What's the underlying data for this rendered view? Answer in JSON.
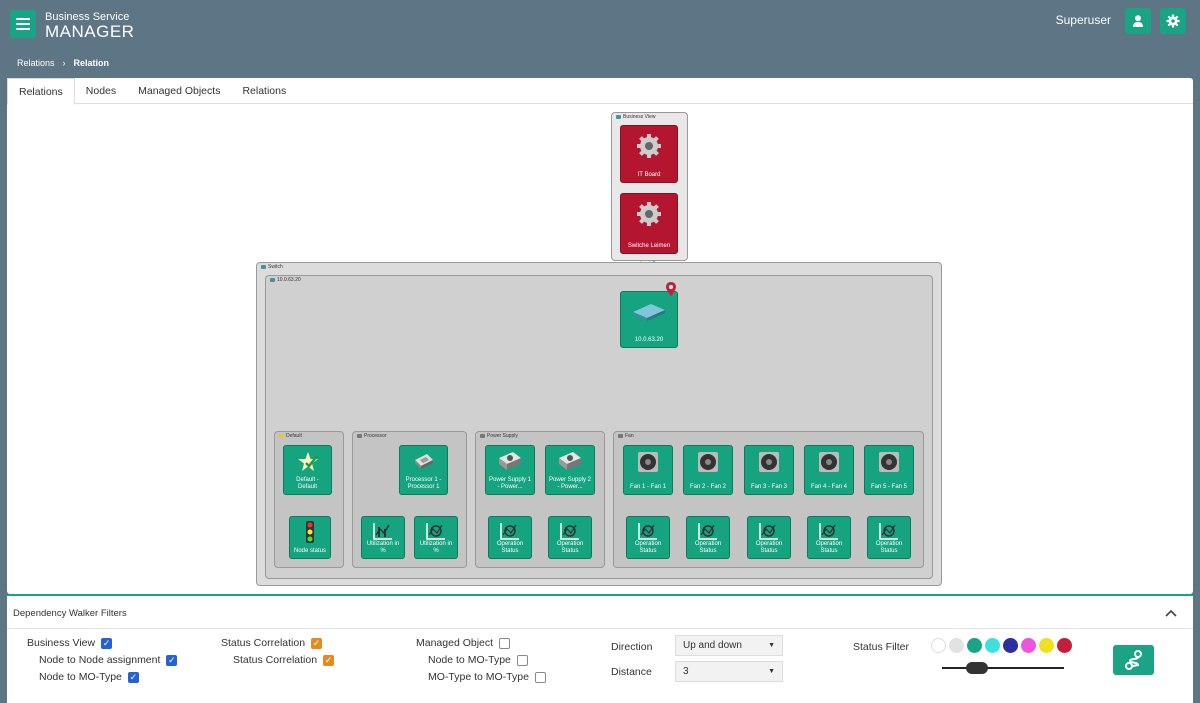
{
  "header": {
    "brand_top": "Business Service",
    "brand_bottom": "MANAGER",
    "user_name": "Superuser"
  },
  "breadcrumb": {
    "parent": "Relations",
    "separator": "›",
    "current": "Relation"
  },
  "tabs": [
    "Relations",
    "Nodes",
    "Managed Objects",
    "Relations"
  ],
  "graph": {
    "groups": {
      "business_view": "Business View",
      "switch": "Switch",
      "host": "10.0.63.20",
      "default": "Default",
      "processor": "Processor",
      "power_supply": "Power Supply",
      "fan": "Fan"
    },
    "nodes": {
      "it_board": "IT Board",
      "switche": "Switche Leimen",
      "host": "10.0.63.20",
      "default": "Default - Default",
      "node_status": "Node status",
      "processor": "Processor 1 - Processor 1",
      "util1": "Utilization in %",
      "util2": "Utilization in %",
      "ps1": "Power Supply 1 - Power...",
      "ps2": "Power Supply 2 - Power...",
      "op_ps1": "Operation Status",
      "op_ps2": "Operation Status",
      "fan1": "Fan 1 - Fan 1",
      "fan2": "Fan 2 - Fan 2",
      "fan3": "Fan 3 - Fan 3",
      "fan4": "Fan 4 - Fan 4",
      "fan5": "Fan 5 - Fan 5",
      "op_fan1": "Operation Status",
      "op_fan2": "Operation Status",
      "op_fan3": "Operation Status",
      "op_fan4": "Operation Status",
      "op_fan5": "Operation Status"
    },
    "colors": {
      "node_ok": "#16a37f",
      "node_critical": "#b4162f",
      "edge_orange": "#f5a623",
      "edge_blue": "#2233cc"
    }
  },
  "filters": {
    "title": "Dependency Walker Filters",
    "business_view": "Business View",
    "node_to_node": "Node to Node assignment",
    "node_to_mo_type_1": "Node to MO-Type",
    "status_correlation": "Status Correlation",
    "status_correlation_sub": "Status Correlation",
    "managed_object": "Managed Object",
    "node_to_mo_type_2": "Node to MO-Type",
    "mo_type_to_mo_type": "MO-Type to MO-Type",
    "direction_label": "Direction",
    "direction_value": "Up and down",
    "distance_label": "Distance",
    "distance_value": "3",
    "status_filter_label": "Status Filter",
    "status_colors": [
      "#ffffff",
      "#e2e2e2",
      "#1aa384",
      "#3fe0e0",
      "#2b2ea0",
      "#ee55dd",
      "#f0e020",
      "#c41e3a"
    ]
  }
}
